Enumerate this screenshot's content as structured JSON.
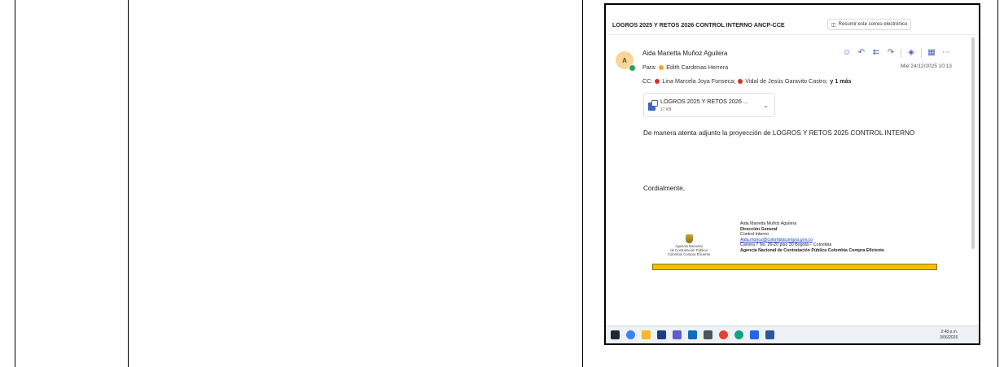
{
  "email": {
    "subject": "LOGROS 2025 Y RETOS 2026 CONTROL INTERNO ANCP-CCE",
    "summarize_label": "Resumir este correo electrónico",
    "avatar_initial": "A",
    "sender": "Aida Marietta Muñoz Aguilera",
    "to_label": "Para:",
    "to_name": "Edith Cardenas Herrera",
    "date": "Mié 24/12/2025 10:13",
    "cc_label": "CC:",
    "cc": [
      "Lina Marcela Joya Fonseca;",
      "Vidal de Jesús Garavito Castro;"
    ],
    "cc_more": "y 1 más",
    "attachment": {
      "name": "LOGROS 2025 Y RETOS 2026 ...",
      "size": "17 KB"
    },
    "body": "De manera atenta adjunto la proyección de LOGROS Y RETOS 2025 CONTROL INTERNO",
    "closing": "Cordialmente,"
  },
  "signature": {
    "logo_lines": [
      "Agencia Nacional",
      "de Contratación Pública",
      "Colombia Compra Eficiente"
    ],
    "name": "Aida Marietta Muñoz Aguilera",
    "dept": "Dirección General",
    "area": "Control Interno",
    "email": "Aida.munoz@colombiacompra.gov.co",
    "address": "Carrera 7 No. 26-20 piso 30 Bogotá – Colombia",
    "agency": "Agencia Nacional de Contratación Pública Colombia Compra Eficiente"
  },
  "taskbar": {
    "time": "2:48 p.m.",
    "date": "3/06/2026"
  },
  "colors": {
    "to_dot": "#f5a623",
    "cc_dot": "#d9302c",
    "presence": "#2aa34a",
    "signature_bar": "#f2c000"
  }
}
